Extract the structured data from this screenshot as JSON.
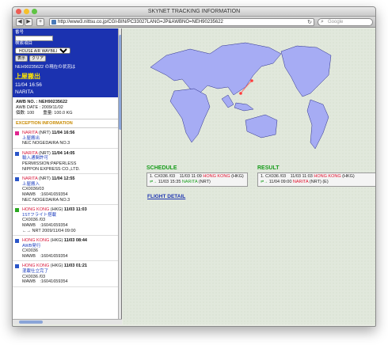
{
  "window": {
    "title": "SKYNET TRACKING INFORMATION"
  },
  "toolbar": {
    "back_label": "◀",
    "forward_label": "▶",
    "add_label": "+",
    "url": "http://www3.nittsu.co.jp/CGI-BIN/PC33027LANG=JP&AWBNO=NEH90235622",
    "reload_label": "↻",
    "search_placeholder": "Google"
  },
  "sidebar": {
    "field1_label": "番号",
    "field2_label": "検索項目",
    "select_value": "HOUSE AIR WAYBILL NUMBER",
    "search_button": "表示",
    "clear_button": "クリア",
    "status_heading": "NEH90235622 の現在の状況は",
    "status_value": "上屋搬出",
    "status_datetime": "11/04 16:56",
    "status_location": "NARITA",
    "awb_no": "AWB NO. : NEH90235622",
    "awb_date": "AWB DATE : 2009/11/02",
    "awb_pieces": "個数: 100　　重量: 100.0 KG",
    "exception_title": "EXCEPTION INFORMATION",
    "events": [
      {
        "loc": "NARITA",
        "code": "(NRT)",
        "dt": "11/04 16:56",
        "status": "上屋搬出",
        "lines": [
          "NEC NOGEDAIRA NO.3"
        ],
        "color": "#e0258f"
      },
      {
        "loc": "NARITA",
        "code": "(NRT)",
        "dt": "11/04 14:05",
        "status": "輸入通関許可",
        "lines": [
          "PERMISSION:PAPERLESS",
          "NIPPON EXPRESS CO.,LTD."
        ],
        "color": "#2a55c8"
      },
      {
        "loc": "NARITA",
        "code": "(NRT)",
        "dt": "11/04 12:55",
        "status": "上屋搬入",
        "lines": [
          "CX0036/03",
          "MAWB　:16041659354",
          "NEC NOGEDAIRA NO.3"
        ],
        "color": "#2a55c8"
      },
      {
        "loc": "HONG KONG",
        "code": "(HKG)",
        "dt": "11/03 11:03",
        "status": "1STフライト搭載",
        "lines": [
          "CX0036 /03",
          "MAWB　:16041659354",
          "←→ NRT 2009/11/04 09:00"
        ],
        "color": "#2aa820"
      },
      {
        "loc": "HONG KONG",
        "code": "(HKG)",
        "dt": "11/03 08:44",
        "status": "AWB発行",
        "lines": [
          "CX0036",
          "MAWB　:16041659354"
        ],
        "color": "#2a55c8"
      },
      {
        "loc": "HONG KONG",
        "code": "(HKG)",
        "dt": "11/03 01:21",
        "status": "混載仕立完了",
        "lines": [
          "CX0036 /03",
          "MAWB　:16041659354"
        ],
        "color": "#2a55c8"
      }
    ]
  },
  "schedule": {
    "heading": "SCHEDULE",
    "row1": "1. CX036 /03　11/03 11:09",
    "origin": "HONG KONG",
    "origin_code": "(HKG)",
    "arrow": "⇌→",
    "row2": "11/03 15:35",
    "dest": "NARITA",
    "dest_code": "(NRT)"
  },
  "result": {
    "heading": "RESULT",
    "row1": "1. CX036 /03　11/03 11:03",
    "origin": "HONG KONG",
    "origin_code": "(HKG)",
    "arrow": "⇌→",
    "row2": "11/04 09:00",
    "dest": "NARITA",
    "dest_code": "(NRT)",
    "extra": "(E)"
  },
  "flight_detail": "FLIGHT DETAIL"
}
